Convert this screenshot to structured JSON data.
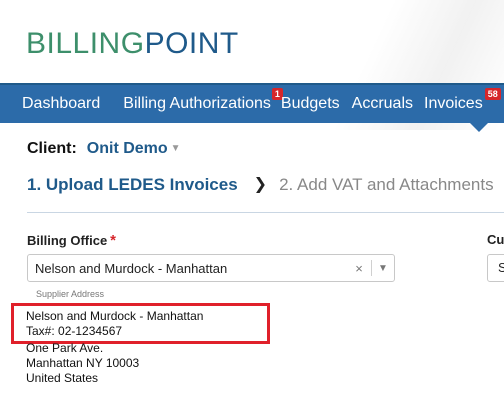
{
  "logo": {
    "part1": "BILLING",
    "part2": "POINT"
  },
  "nav": {
    "items": [
      {
        "label": "Dashboard"
      },
      {
        "label": "Billing Authorizations",
        "badge": "1"
      },
      {
        "label": "Budgets"
      },
      {
        "label": "Accruals"
      },
      {
        "label": "Invoices",
        "badge": "58"
      }
    ]
  },
  "client": {
    "label": "Client:",
    "value": "Onit Demo"
  },
  "steps": {
    "step1": "1. Upload LEDES Invoices",
    "step2": "2. Add VAT and Attachments"
  },
  "form": {
    "billing_office_label": "Billing Office",
    "required_mark": "*",
    "billing_office_value": "Nelson and Murdock - Manhattan",
    "clear_symbol": "×",
    "second_label": "Cu",
    "second_value": "S",
    "supplier_address_label": "Supplier Address",
    "address": {
      "line1": "Nelson and Murdock - Manhattan",
      "line2": "Tax#: 02-1234567",
      "line3": "One Park Ave.",
      "line4": "Manhattan NY 10003",
      "line5": "United States"
    }
  },
  "colors": {
    "brand_green": "#3d8f6b",
    "brand_blue": "#1f5a8a",
    "nav_bg": "#2c6ba9",
    "badge_red": "#d6262b",
    "highlight_red": "#e0202a"
  }
}
